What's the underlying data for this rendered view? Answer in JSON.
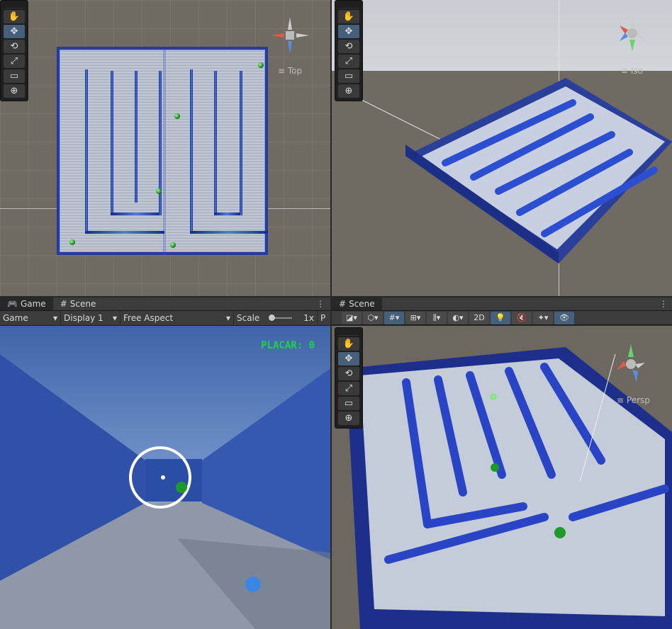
{
  "top_left": {
    "view_label": "Top"
  },
  "top_right": {
    "view_label": "Iso"
  },
  "bottom_left": {
    "tabs": [
      {
        "label": "Game",
        "icon": "gamepad-icon"
      },
      {
        "label": "Scene",
        "icon": "hash-icon"
      }
    ],
    "toolbar": {
      "mode": "Game",
      "display": "Display 1",
      "aspect": "Free Aspect",
      "scale_label": "Scale",
      "scale_value": "1x",
      "trailing": "P"
    },
    "hud": {
      "score": "PLACAR: 0"
    }
  },
  "bottom_right": {
    "tabs": [
      {
        "label": "Scene",
        "icon": "hash-icon"
      }
    ],
    "toolbar": {
      "mode_2d": "2D"
    },
    "view_label": "Persp"
  },
  "tools": [
    "hand-icon",
    "move-icon",
    "rotate-icon",
    "scale-icon",
    "rect-icon",
    "transform-icon"
  ]
}
